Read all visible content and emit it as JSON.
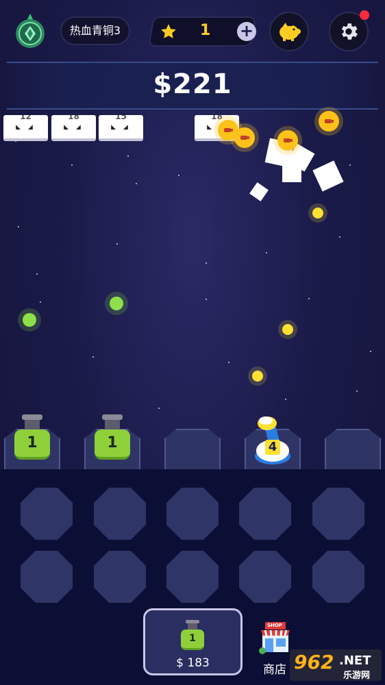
{
  "header": {
    "rank_name": "热血青铜3",
    "stars_count": "1",
    "plus_symbol": "+",
    "icons": [
      "rank-badge-icon",
      "star-icon",
      "piggy-bank-icon",
      "gear-icon"
    ]
  },
  "money": "$221",
  "bricks": [
    {
      "label": "12"
    },
    {
      "label": "18"
    },
    {
      "label": "15"
    },
    {
      "label": "18"
    }
  ],
  "cannons": [
    {
      "level": "1"
    },
    {
      "level": "1"
    },
    {
      "level": ""
    },
    {
      "level": "4"
    },
    {
      "level": ""
    }
  ],
  "buy": {
    "cannon_level": "1",
    "price": "$ 183"
  },
  "shop": {
    "sign": "SHOP",
    "label": "商店"
  },
  "watermark": {
    "brand": "962",
    "suffix": ".NET",
    "sub": "乐游网"
  },
  "colors": {
    "background": "#1b1b4a",
    "panel": "#0c0f35",
    "cannon_green": "#8fd03a",
    "coin_gold": "#ffc21a",
    "accent_red": "#ff2a3a"
  }
}
